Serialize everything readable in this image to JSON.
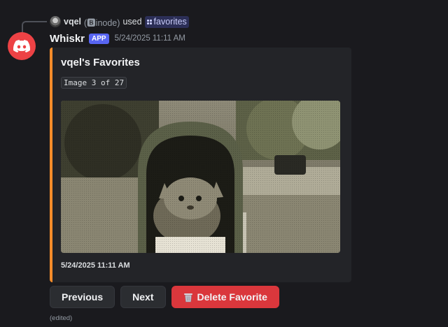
{
  "reply": {
    "user": "vqel",
    "tag": "(🅱inode)",
    "used": "used",
    "command": "favorites"
  },
  "message": {
    "author": "Whiskr",
    "badge": "APP",
    "timestamp": "5/24/2025 11:11 AM",
    "edited": "(edited)"
  },
  "embed": {
    "title": "vqel's Favorites",
    "description": "Image 3 of 27",
    "footer": "5/24/2025 11:11 AM",
    "accent_color": "#f48c2a",
    "image_alt": "kitten in a mailbox"
  },
  "buttons": {
    "previous": "Previous",
    "next": "Next",
    "delete": "Delete Favorite",
    "delete_icon": "wastebasket-icon"
  },
  "colors": {
    "background": "#1a1a1e",
    "avatar": "#ed4245",
    "app_badge": "#5865f2",
    "danger": "#da373c"
  }
}
